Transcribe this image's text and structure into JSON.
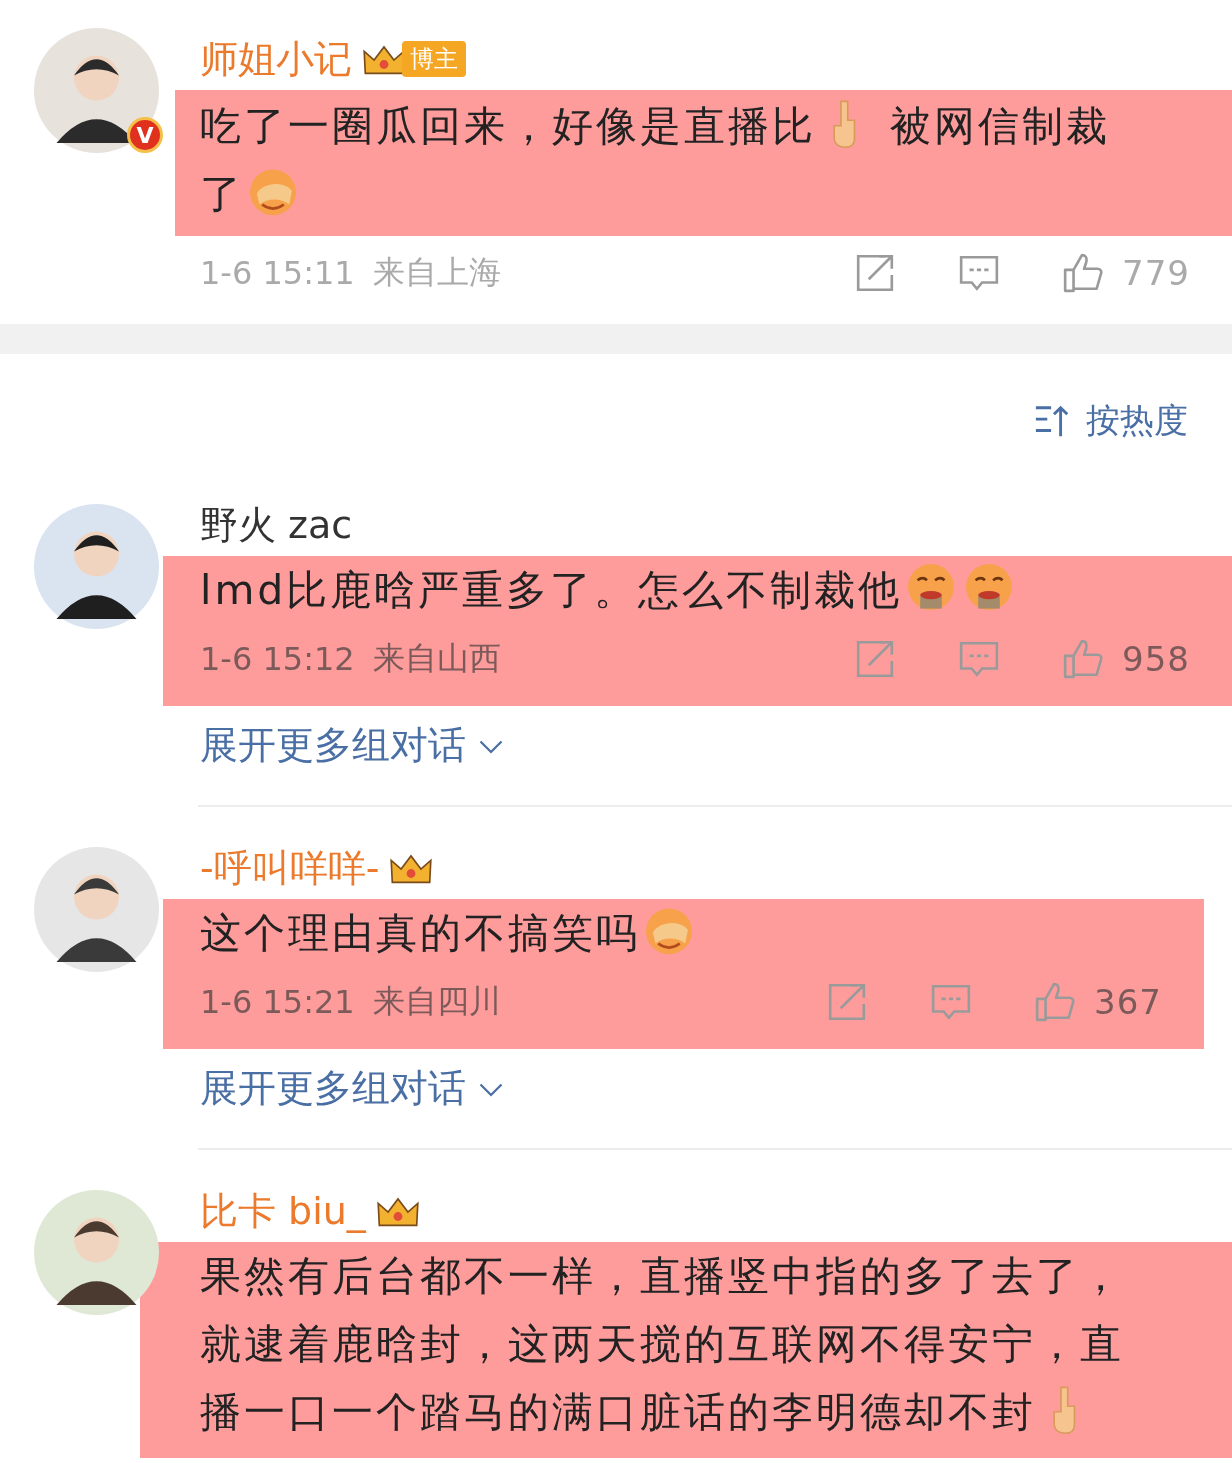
{
  "post": {
    "user": {
      "name": "师姐小记",
      "vip": true,
      "verified_mark": "V",
      "tag": "博主"
    },
    "highlighted": true,
    "content": [
      {
        "kind": "text",
        "text": "吃了一圈瓜回来，好像是直播比"
      },
      {
        "kind": "finger"
      },
      {
        "kind": "text",
        "text": " 被网信制裁了"
      },
      {
        "kind": "facepalm"
      }
    ],
    "time": "1-6 15:11",
    "location": "来自上海",
    "likes": "779"
  },
  "sort": {
    "label": "按热度"
  },
  "comments": [
    {
      "user": {
        "name": "野火 zac",
        "vip": false
      },
      "highlighted": true,
      "content": [
        {
          "kind": "text",
          "text": "lmd比鹿晗严重多了。怎么不制裁他"
        },
        {
          "kind": "nauseous"
        },
        {
          "kind": "nauseous"
        }
      ],
      "time": "1-6 15:12",
      "location": "来自山西",
      "likes": "958",
      "expand": "展开更多组对话"
    },
    {
      "user": {
        "name": "-呼叫咩咩-",
        "vip": true
      },
      "highlighted": true,
      "content": [
        {
          "kind": "text",
          "text": "这个理由真的不搞笑吗"
        },
        {
          "kind": "facepalm"
        }
      ],
      "time": "1-6 15:21",
      "location": "来自四川",
      "likes": "367",
      "expand": "展开更多组对话"
    },
    {
      "user": {
        "name": "比卡 biu_",
        "vip": true
      },
      "highlighted": true,
      "content": [
        {
          "kind": "text",
          "text": "果然有后台都不一样，直播竖中指的多了去了，就逮着鹿晗封，这两天搅的互联网不得安宁，直播一口一个踏马的满口脏话的李明德却不封"
        },
        {
          "kind": "finger"
        }
      ]
    }
  ]
}
